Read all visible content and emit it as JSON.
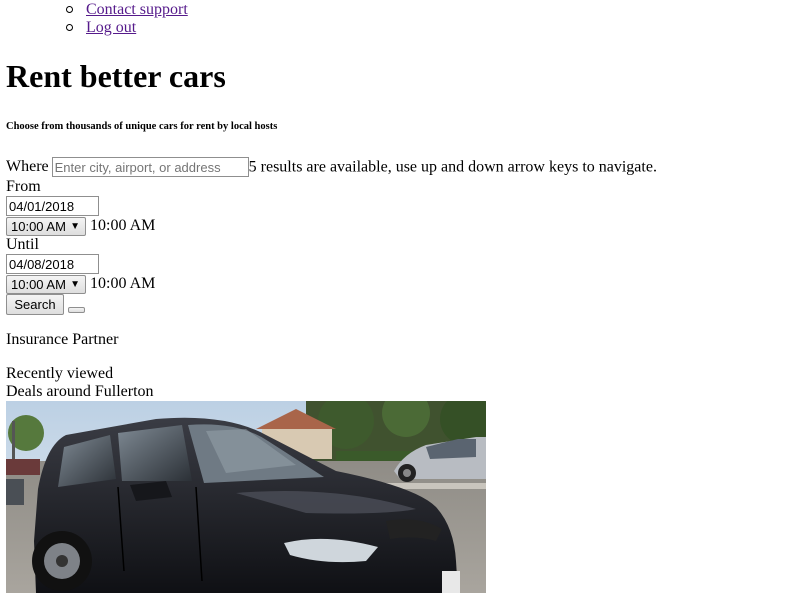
{
  "nav": {
    "items": [
      {
        "label": "Contact support"
      },
      {
        "label": "Log out"
      }
    ]
  },
  "hero": {
    "title": "Rent better cars",
    "subtitle": "Choose from thousands of unique cars for rent by local hosts"
  },
  "search": {
    "where_label": "Where",
    "where_placeholder": "Enter city, airport, or address",
    "where_value": "",
    "results_status": "5 results are available, use up and down arrow keys to navigate.",
    "from_label": "From",
    "from_date": "04/01/2018",
    "from_time_selected": "10:00 AM",
    "from_time_text": "10:00 AM",
    "until_label": "Until",
    "until_date": "04/08/2018",
    "until_time_selected": "10:00 AM",
    "until_time_text": "10:00 AM",
    "search_button": "Search"
  },
  "sections": {
    "insurance": "Insurance Partner",
    "recently_viewed": "Recently viewed",
    "deals": "Deals around Fullerton"
  },
  "icons": {
    "bullet": "circle-bullet-icon",
    "dropdown": "chevron-down-icon"
  },
  "colors": {
    "link": "#551a8b",
    "button_border": "#8f8f8f"
  }
}
